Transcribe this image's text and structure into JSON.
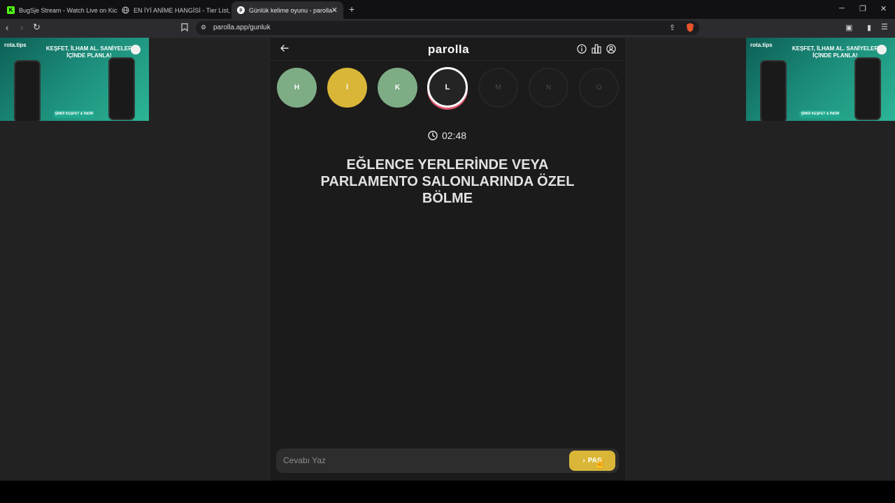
{
  "browser": {
    "tabs": [
      {
        "title": "BugSje Stream - Watch Live on Kick",
        "active": false,
        "icon": "kick-icon",
        "color": "#53fc18"
      },
      {
        "title": "EN İYİ ANİME HANGİSİ - Tier List, Kö",
        "active": false,
        "icon": "globe-icon"
      },
      {
        "title": "Günlük kelime oyunu - parolla -",
        "active": true,
        "icon": "parolla-icon"
      }
    ],
    "url": "parolla.app/gunluk"
  },
  "ads": {
    "brand": "rota.tips",
    "headline": "KEŞFET, İLHAM AL. SANİYELER İÇİNDE PLANLA!",
    "cta": "ŞİMDİ KEŞFET & İNDİR"
  },
  "app": {
    "logo": "parolla",
    "letters": [
      {
        "char": "H",
        "state": "correct"
      },
      {
        "char": "İ",
        "state": "skipped"
      },
      {
        "char": "K",
        "state": "correct"
      },
      {
        "char": "L",
        "state": "current"
      },
      {
        "char": "M",
        "state": "pending"
      },
      {
        "char": "N",
        "state": "pending"
      },
      {
        "char": "O",
        "state": "pending"
      }
    ],
    "timer": "02:48",
    "question": "EĞLENCE YERLERİNDE VEYA PARLAMENTO SALONLARINDA ÖZEL BÖLME",
    "answer_placeholder": "Cevabı Yaz",
    "pass_label": "PAS"
  },
  "colors": {
    "correct": "#7eac85",
    "skipped": "#d9b637",
    "current_ring": "#e0566f",
    "accent": "#d9b637"
  }
}
